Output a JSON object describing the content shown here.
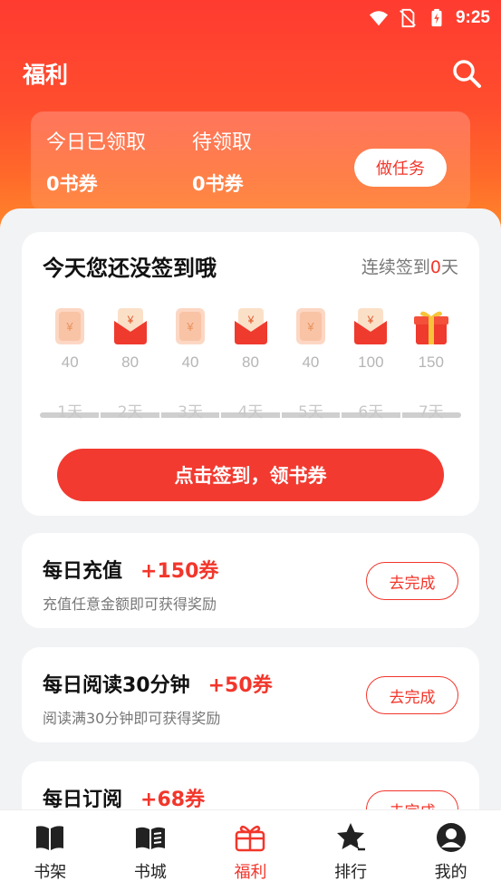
{
  "status": {
    "time": "9:25"
  },
  "header": {
    "title": "福利"
  },
  "summary": {
    "today_label": "今日已领取",
    "today_value": "0书券",
    "pending_label": "待领取",
    "pending_value": "0书券",
    "task_button": "做任务"
  },
  "checkin": {
    "title": "今天您还没签到哦",
    "streak_prefix": "连续签到",
    "streak_count": "0",
    "streak_suffix": "天",
    "days": [
      {
        "amount": "40",
        "label": "1天",
        "icon": "ticket-icon"
      },
      {
        "amount": "80",
        "label": "2天",
        "icon": "red-envelope-icon"
      },
      {
        "amount": "40",
        "label": "3天",
        "icon": "ticket-icon"
      },
      {
        "amount": "80",
        "label": "4天",
        "icon": "red-envelope-icon"
      },
      {
        "amount": "40",
        "label": "5天",
        "icon": "ticket-icon"
      },
      {
        "amount": "100",
        "label": "6天",
        "icon": "red-envelope-icon"
      },
      {
        "amount": "150",
        "label": "7天",
        "icon": "gift-icon"
      }
    ],
    "button": "点击签到，领书券"
  },
  "tasks": [
    {
      "name": "每日充值",
      "reward": "+150券",
      "desc": "充值任意金额即可获得奖励",
      "button": "去完成"
    },
    {
      "name": "每日阅读30分钟",
      "reward": "+50券",
      "desc": "阅读满30分钟即可获得奖励",
      "button": "去完成"
    },
    {
      "name": "每日订阅",
      "reward": "+68券",
      "desc": "",
      "button": "去完成"
    }
  ],
  "nav": [
    {
      "label": "书架",
      "icon": "bookshelf-icon"
    },
    {
      "label": "书城",
      "icon": "book-store-icon"
    },
    {
      "label": "福利",
      "icon": "gift-box-icon",
      "active": true
    },
    {
      "label": "排行",
      "icon": "ranking-star-icon"
    },
    {
      "label": "我的",
      "icon": "profile-icon"
    }
  ],
  "colors": {
    "accent": "#f2362b",
    "header_top": "#ff3b30",
    "header_bottom": "#ff8a2c"
  }
}
